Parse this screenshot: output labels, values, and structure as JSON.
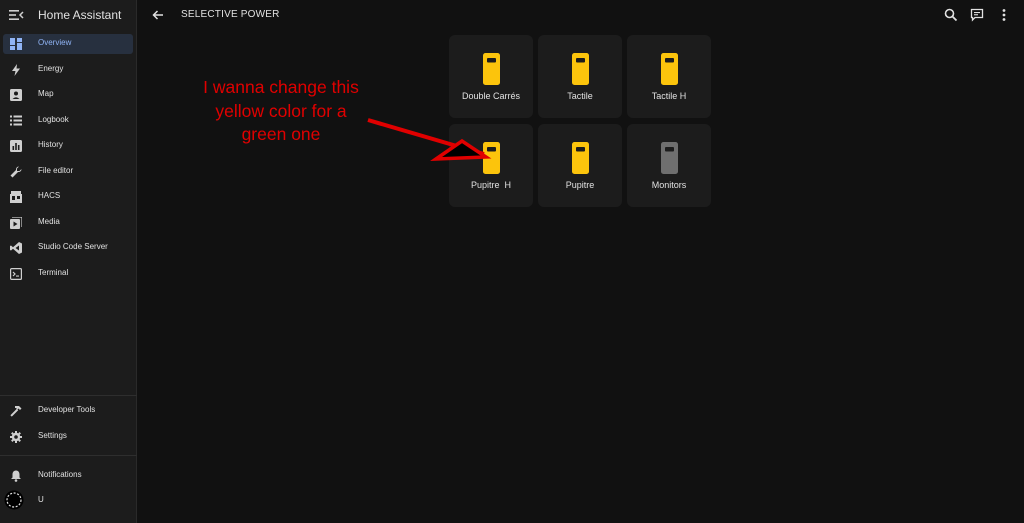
{
  "app": {
    "title": "Home Assistant"
  },
  "sidebar": {
    "items": [
      {
        "label": "Overview",
        "icon": "dashboard-icon",
        "active": true
      },
      {
        "label": "Energy",
        "icon": "lightning-bolt-icon"
      },
      {
        "label": "Map",
        "icon": "map-icon"
      },
      {
        "label": "Logbook",
        "icon": "list-icon"
      },
      {
        "label": "History",
        "icon": "chart-icon"
      },
      {
        "label": "File editor",
        "icon": "wrench-icon"
      },
      {
        "label": "HACS",
        "icon": "hacs-store-icon"
      },
      {
        "label": "Media",
        "icon": "media-play-icon"
      },
      {
        "label": "Studio Code Server",
        "icon": "vscode-icon"
      },
      {
        "label": "Terminal",
        "icon": "terminal-icon"
      }
    ],
    "bottom_items": [
      {
        "label": "Developer Tools",
        "icon": "hammer-icon"
      },
      {
        "label": "Settings",
        "icon": "gear-icon"
      },
      {
        "label": "Notifications",
        "icon": "bell-icon"
      },
      {
        "label": "U",
        "icon": "avatar"
      }
    ]
  },
  "header": {
    "title": "SELECTIVE POWER",
    "actions": [
      "search-icon",
      "assist-chat-icon",
      "more-vertical-icon"
    ]
  },
  "tiles": [
    {
      "label": "Double Carrés",
      "state": "on",
      "icon": "power-socket-icon"
    },
    {
      "label": "Tactile",
      "state": "on",
      "icon": "power-socket-icon"
    },
    {
      "label": "Tactile H",
      "state": "on",
      "icon": "power-socket-icon"
    },
    {
      "label": "Pupitre  H",
      "state": "on",
      "icon": "power-socket-icon"
    },
    {
      "label": "Pupitre",
      "state": "on",
      "icon": "power-socket-icon"
    },
    {
      "label": "Monitors",
      "state": "off",
      "icon": "power-socket-icon"
    }
  ],
  "annotation": {
    "lines": [
      "I wanna change this",
      "yellow color for a",
      "green one"
    ]
  },
  "colors": {
    "on": "#fcc40c",
    "off": "#6f6f6f",
    "accent": "#90b4f5",
    "annotation": "#e00000"
  }
}
